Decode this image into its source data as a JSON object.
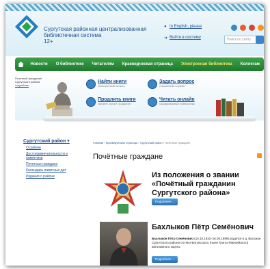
{
  "header": {
    "title_line1": "Сургутская районная централизованная",
    "title_line2": "библиотечная система",
    "age": "12+",
    "lang_link": "In English, please",
    "login_link": "Войти в систему",
    "search_placeholder": "Поиск по сайту"
  },
  "nav": {
    "items": [
      {
        "label": "Новости",
        "highlight": false
      },
      {
        "label": "О библиотеке",
        "highlight": false
      },
      {
        "label": "Читателям",
        "highlight": false
      },
      {
        "label": "Краеведческая страница",
        "highlight": false
      },
      {
        "label": "Электронная библиотека",
        "highlight": true
      },
      {
        "label": "Коллегам",
        "highlight": false
      }
    ]
  },
  "banner": {
    "note_line1": "Почетный гражданин",
    "note_line2": "Сургутского района",
    "note_link": "подробнее",
    "items": [
      {
        "title": "Найти книги",
        "sub": "Электронный каталог"
      },
      {
        "title": "Задать вопрос",
        "sub": "Справочная служба"
      },
      {
        "title": "Продлить книги",
        "sub": "Читаете книги? Продлите!"
      },
      {
        "title": "Читать онлайн",
        "sub": "Оцифрованные библиотеки"
      }
    ]
  },
  "sidebar": {
    "title": "Сургутский район",
    "items": [
      {
        "label": "О районе"
      },
      {
        "label": "Достопримечательности и памятники"
      },
      {
        "label": "Почетные граждане"
      },
      {
        "label": "Календарь памятных дат"
      },
      {
        "label": "Издания о районе"
      }
    ]
  },
  "breadcrumb": {
    "items": [
      "Главная",
      "Краеведческая страница",
      "Сургутский район",
      "Почетные граждане"
    ]
  },
  "main": {
    "title": "Почётные граждане",
    "article1_title": "Из положения о звании «Почётный гражданин Сургутского района»",
    "more_label": "Подробнее ...",
    "article2_title": "Бахлыков Пётр Семёнович",
    "article2_name": "Бахлыков Пётр Семёнович",
    "article2_text": "(10.10.1932–16.05.1999) родился в д. Высокое Сургутского района Остяко-Вогульского (ныне Ханты-Мансийского) автономного округа."
  },
  "colors": {
    "brand_blue": "#1a4f8c",
    "nav_green": "#2a8c37",
    "highlight": "#ffe86a",
    "button_blue": "#3b86c6"
  },
  "icons": [
    "logo-icon",
    "globe-icon",
    "login-icon",
    "search-icon",
    "home-icon",
    "rss-icon"
  ]
}
